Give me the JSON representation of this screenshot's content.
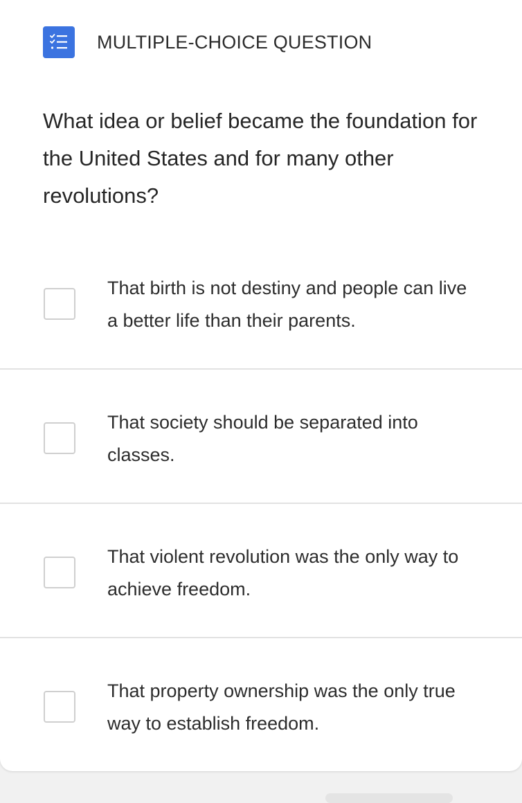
{
  "header": {
    "icon": "checklist-icon",
    "type_label": "MULTIPLE-CHOICE QUESTION",
    "accent_color": "#3b73e0"
  },
  "question": {
    "text": "What idea or belief became the foundation for the United States and for many other revolutions?"
  },
  "options": [
    {
      "text": "That birth is not destiny and people can live a better life than their parents.",
      "checked": false
    },
    {
      "text": "That society should be separated into classes.",
      "checked": false
    },
    {
      "text": "That violent revolution was the only way to achieve freedom.",
      "checked": false
    },
    {
      "text": "That property ownership was the only true way to establish freedom.",
      "checked": false
    }
  ]
}
